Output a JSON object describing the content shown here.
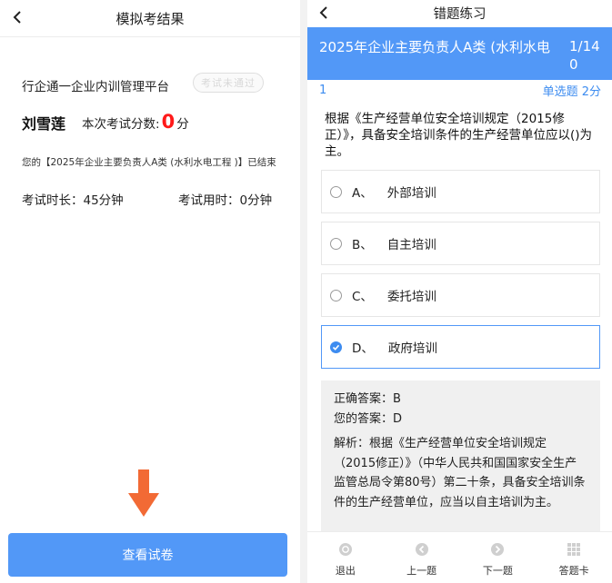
{
  "left": {
    "title": "模拟考结果",
    "platform": "行企通一企业内训管理平台",
    "stamp": "考试未通过",
    "name": "刘雪莲",
    "score_label": "本次考试分数:",
    "score_value": "0",
    "score_unit": "分",
    "ended_text": "您的【2025年企业主要负责人A类 (水利水电工程 )】已结束",
    "duration_text": "考试时长：45分钟",
    "used_text": "考试用时：0分钟",
    "view_button": "查看试卷",
    "colors": {
      "accent": "#5298f7",
      "score": "#ff1a1a",
      "arrow": "#f26a35"
    }
  },
  "right": {
    "title": "错题练习",
    "exam_title": "2025年企业主要负责人A类 (水利水电",
    "progress": "1/140",
    "question_no": "1",
    "question_type": "单选题 2分",
    "question_text": "根据《生产经营单位安全培训规定（2015修正）》，具备安全培训条件的生产经营单位应以()为主。",
    "options": [
      {
        "label": "A、",
        "text": "外部培训",
        "selected": false
      },
      {
        "label": "B、",
        "text": "自主培训",
        "selected": false
      },
      {
        "label": "C、",
        "text": "委托培训",
        "selected": false
      },
      {
        "label": "D、",
        "text": "政府培训",
        "selected": true
      }
    ],
    "correct_answer": "正确答案：B",
    "your_answer": "您的答案：D",
    "analysis": "解析：根据《生产经营单位安全培训规定（2015修正）》（中华人民共和国国家安全生产监管总局令第80号）第二十条，具备安全培训条件的生产经营单位，应当以自主培训为主。",
    "tabs": [
      {
        "label": "退出",
        "icon": "exit-icon"
      },
      {
        "label": "上一题",
        "icon": "prev-icon"
      },
      {
        "label": "下一题",
        "icon": "next-icon"
      },
      {
        "label": "答题卡",
        "icon": "grid-icon"
      }
    ]
  }
}
